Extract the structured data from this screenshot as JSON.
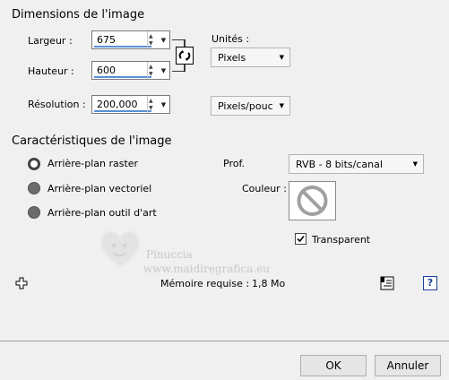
{
  "image_dimensions": {
    "title": "Dimensions de l'image",
    "width_label": "Largeur :",
    "width_value": "675",
    "height_label": "Hauteur :",
    "height_value": "600",
    "resolution_label": "Résolution :",
    "resolution_value": "200,000",
    "units_label": "Unités :",
    "units_value": "Pixels",
    "resolution_units_value": "Pixels/pouc"
  },
  "image_characteristics": {
    "title": "Caractéristiques de l'image",
    "background_options": [
      "Arrière-plan raster",
      "Arrière-plan vectoriel",
      "Arrière-plan outil d'art"
    ],
    "selected_background": "Arrière-plan raster",
    "depth_label": "Prof.",
    "depth_value": "RVB - 8 bits/canal",
    "color_label": "Couleur :",
    "transparent_label": "Transparent",
    "transparent_checked": true
  },
  "memory": {
    "label": "Mémoire requise :",
    "value": "1,8 Mo"
  },
  "watermark": {
    "line1": "Pinuccia",
    "line2": "www.maidiregrafica.eu"
  },
  "buttons": {
    "ok": "OK",
    "cancel": "Annuler"
  },
  "icons": [
    "link-aspect-icon",
    "move-cross-icon",
    "preset-notes-icon",
    "help-icon",
    "no-color-icon",
    "check-icon"
  ]
}
